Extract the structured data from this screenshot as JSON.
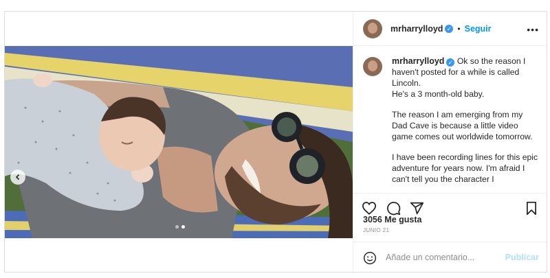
{
  "post": {
    "username": "mrharrylloyd",
    "follow_label": "Seguir",
    "more_label": "•••",
    "caption_paragraphs": [
      "Ok so the reason I haven't posted for a while is called Lincoln.\nHe's a 3 month-old baby.",
      "The reason I am emerging from my Dad Cave is because a little video game comes out worldwide tomorrow.",
      "I have been recording lines for this epic adventure for years now. I'm afraid I can't tell you the character I"
    ],
    "likes_label": "3056 Me gusta",
    "date_label": "JUNIO 21",
    "comment": {
      "placeholder": "Añade un comentario...",
      "publish_label": "Publicar"
    },
    "media": {
      "slide_count": 2,
      "active_slide": 2
    }
  },
  "icons": [
    "chevron-left-icon",
    "verified-badge-icon",
    "more-icon",
    "heart-icon",
    "comment-icon",
    "share-icon",
    "bookmark-icon",
    "emoji-icon"
  ],
  "colors": {
    "accent": "#0095f6",
    "verified": "#3897f0",
    "text": "#262626",
    "muted": "#8e8e8e",
    "publish_disabled": "#b2dffc"
  }
}
